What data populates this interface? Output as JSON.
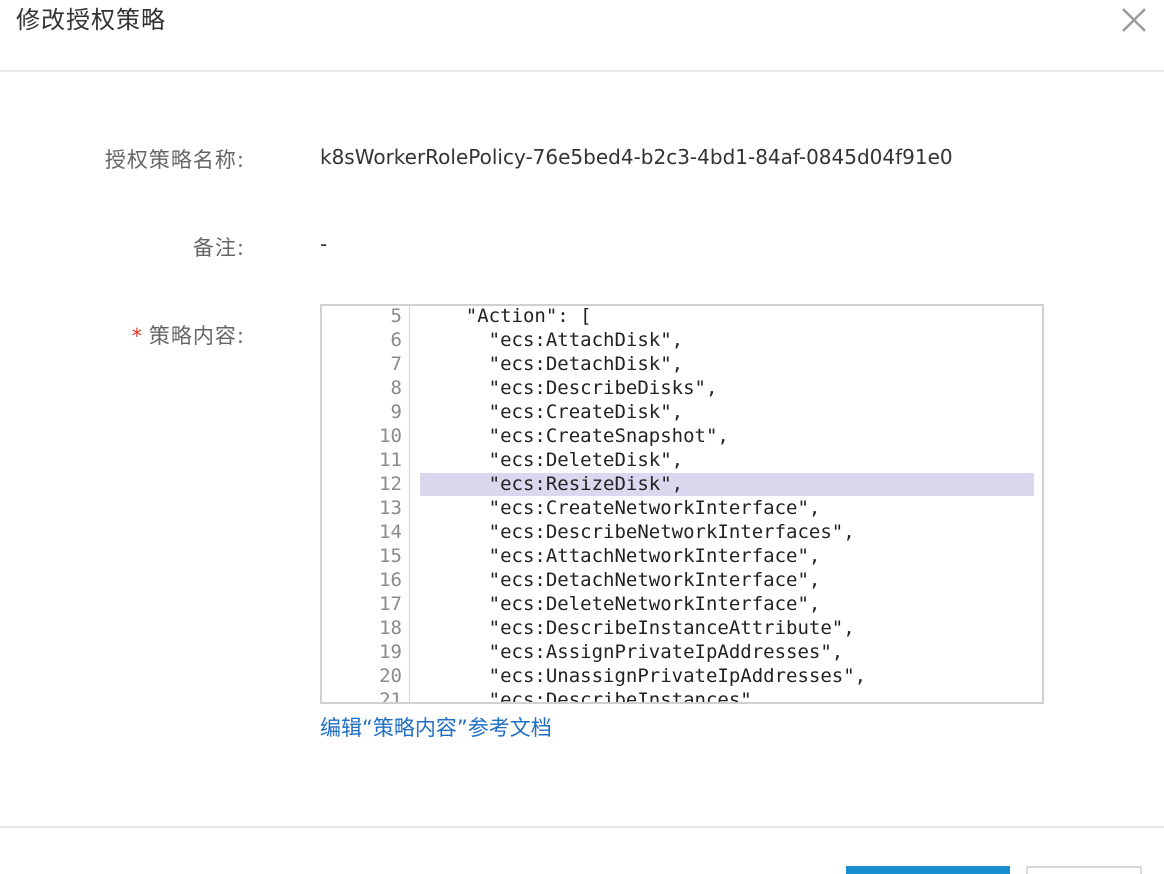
{
  "dialog": {
    "title": "修改授权策略"
  },
  "form": {
    "policy_name_label": "授权策略名称:",
    "policy_name_value": "k8sWorkerRolePolicy-76e5bed4-b2c3-4bd1-84af-0845d04f91e0",
    "remark_label": "备注:",
    "remark_value": "-",
    "required_mark": "*",
    "content_label": "策略内容:",
    "doc_link": "编辑“策略内容”参考文档"
  },
  "editor": {
    "highlighted_line": 12,
    "lines": [
      {
        "n": "5",
        "text": "    \"Action\": ["
      },
      {
        "n": "6",
        "text": "      \"ecs:AttachDisk\","
      },
      {
        "n": "7",
        "text": "      \"ecs:DetachDisk\","
      },
      {
        "n": "8",
        "text": "      \"ecs:DescribeDisks\","
      },
      {
        "n": "9",
        "text": "      \"ecs:CreateDisk\","
      },
      {
        "n": "10",
        "text": "      \"ecs:CreateSnapshot\","
      },
      {
        "n": "11",
        "text": "      \"ecs:DeleteDisk\","
      },
      {
        "n": "12",
        "text": "      \"ecs:ResizeDisk\","
      },
      {
        "n": "13",
        "text": "      \"ecs:CreateNetworkInterface\","
      },
      {
        "n": "14",
        "text": "      \"ecs:DescribeNetworkInterfaces\","
      },
      {
        "n": "15",
        "text": "      \"ecs:AttachNetworkInterface\","
      },
      {
        "n": "16",
        "text": "      \"ecs:DetachNetworkInterface\","
      },
      {
        "n": "17",
        "text": "      \"ecs:DeleteNetworkInterface\","
      },
      {
        "n": "18",
        "text": "      \"ecs:DescribeInstanceAttribute\","
      },
      {
        "n": "19",
        "text": "      \"ecs:AssignPrivateIpAddresses\","
      },
      {
        "n": "20",
        "text": "      \"ecs:UnassignPrivateIpAddresses\","
      },
      {
        "n": "21",
        "text": "      \"ecs:DescribeInstances\""
      }
    ]
  },
  "colors": {
    "primary": "#1a8fd0",
    "link": "#1f6fc5",
    "required": "#e0301e",
    "highlight": "#d9d8ee"
  },
  "icons": {
    "close": "close-icon"
  }
}
